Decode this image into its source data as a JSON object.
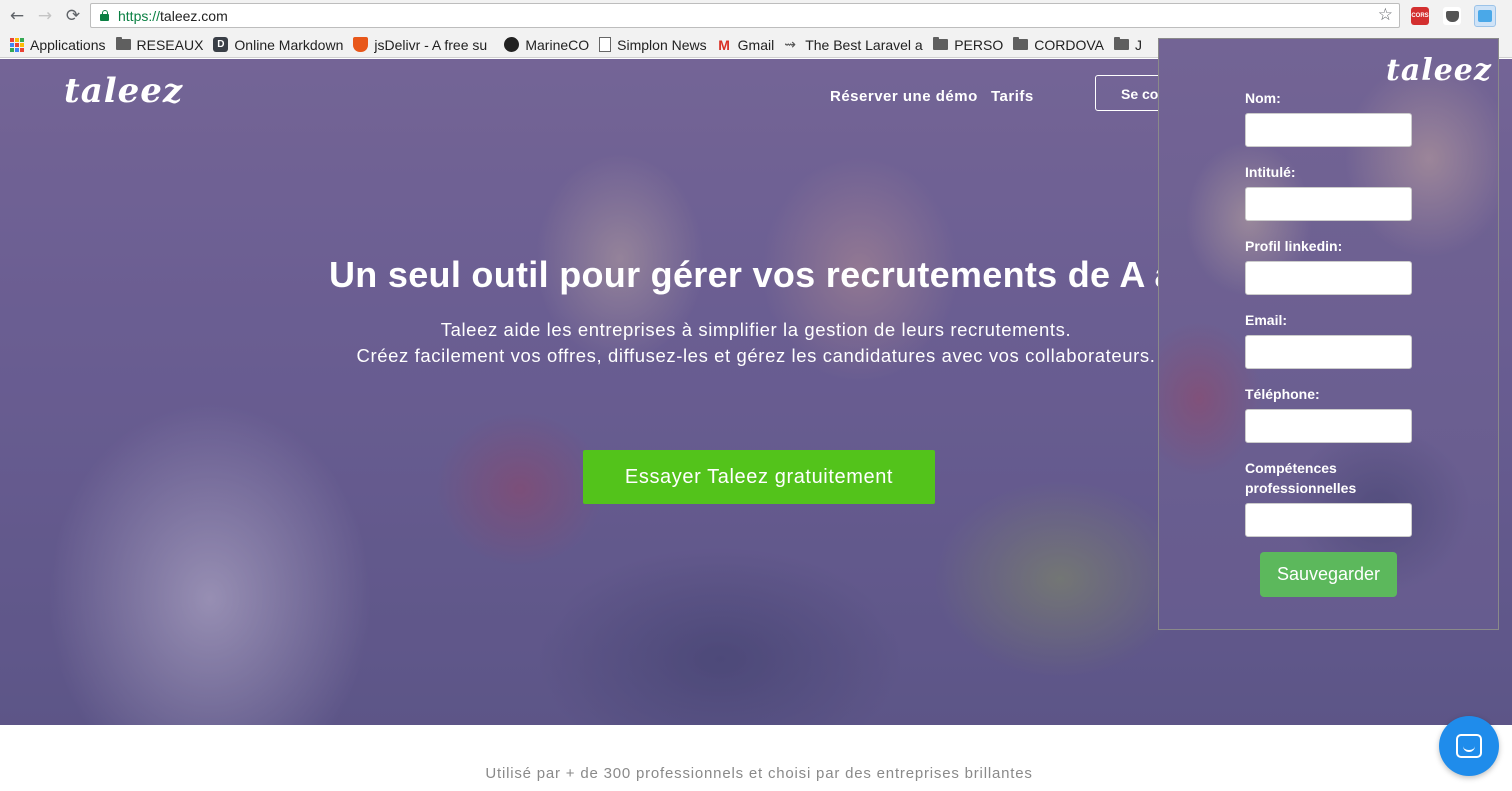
{
  "browser": {
    "url_protocol": "https://",
    "url_host": "taleez.com",
    "back_icon": "←",
    "forward_icon": "→",
    "reload_icon": "⟳",
    "star_icon": "☆",
    "cors_label": "CORS",
    "menu_icon": "⋮"
  },
  "bookmarks": [
    {
      "label": "Applications",
      "icon": "apps-grid-icon"
    },
    {
      "label": "RESEAUX",
      "icon": "folder-icon"
    },
    {
      "label": "Online Markdown",
      "icon": "d-logo-icon"
    },
    {
      "label": "jsDelivr - A free su",
      "icon": "shield-icon"
    },
    {
      "label": "MarineCO",
      "icon": "github-icon"
    },
    {
      "label": "Simplon News",
      "icon": "document-icon"
    },
    {
      "label": "Gmail",
      "icon": "gmail-icon",
      "glyph": "M"
    },
    {
      "label": "The Best Laravel a",
      "icon": "laravel-icon",
      "glyph": "⇝"
    },
    {
      "label": "PERSO",
      "icon": "folder-icon"
    },
    {
      "label": "CORDOVA",
      "icon": "folder-icon"
    },
    {
      "label": "J",
      "icon": "folder-icon"
    }
  ],
  "site": {
    "logo": "taleez",
    "nav": {
      "demo": "Réserver une démo",
      "pricing": "Tarifs",
      "login": "Se connecter"
    },
    "headline": "Un seul outil pour gérer vos recrutements de A à Z",
    "subline_1": "Taleez aide les entreprises à simplifier la gestion de leurs recrutements.",
    "subline_2": "Créez facilement vos offres, diffusez-les et gérez les candidatures avec vos collaborateurs.",
    "cta": "Essayer Taleez gratuitement",
    "trust": "Utilisé par + de 300 professionnels et choisi par des entreprises brillantes"
  },
  "popup": {
    "logo": "taleez",
    "fields": {
      "nom": {
        "label": "Nom:",
        "value": ""
      },
      "intitule": {
        "label": "Intitulé:",
        "value": ""
      },
      "linkedin": {
        "label": "Profil linkedin:",
        "value": ""
      },
      "email": {
        "label": "Email:",
        "value": ""
      },
      "telephone": {
        "label": "Téléphone:",
        "value": ""
      },
      "competences": {
        "label_1": "Compétences",
        "label_2": "professionnelles",
        "value": ""
      }
    },
    "save": "Sauvegarder"
  },
  "colors": {
    "cta_green": "#53c31b",
    "save_green": "#5cb85c",
    "chat_blue": "#1f8ceb",
    "hero_overlay": "#6e6394"
  }
}
